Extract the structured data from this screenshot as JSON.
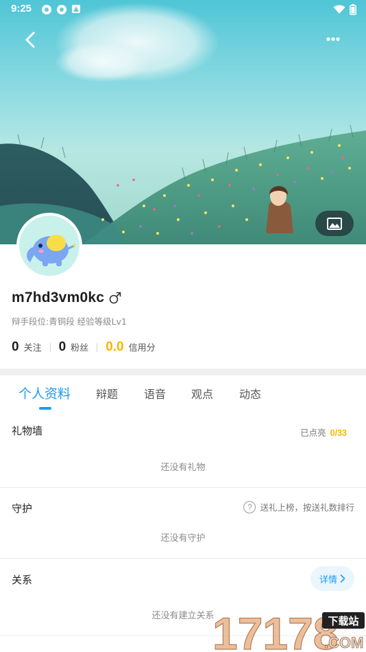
{
  "status_bar": {
    "time": "9:25"
  },
  "header": {
    "back_icon": "chevron-left-icon",
    "more_icon": "more-dots-icon",
    "wallpaper_icon": "image-icon"
  },
  "profile": {
    "username": "m7hd3vm0kc",
    "gender_symbol": "♂",
    "rank_line": "辩手段位:青铜段 经验等级Lv1",
    "stats": [
      {
        "value": "0",
        "label": "关注"
      },
      {
        "value": "0",
        "label": "粉丝"
      },
      {
        "value": "0.0",
        "label": "信用分"
      }
    ]
  },
  "tabs": [
    {
      "label": "个人资料",
      "active": true
    },
    {
      "label": "辩题",
      "active": false
    },
    {
      "label": "语音",
      "active": false
    },
    {
      "label": "观点",
      "active": false
    },
    {
      "label": "动态",
      "active": false
    }
  ],
  "gift_wall": {
    "title": "礼物墙",
    "lit_label": "已点亮",
    "lit_count": "0/33",
    "empty_text": "还没有礼物"
  },
  "guard": {
    "title": "守护",
    "hint": "送礼上榜，按送礼数排行",
    "empty_text": "还没有守护"
  },
  "relations": {
    "title": "关系",
    "details_label": "详情",
    "empty_text": "还没有建立关系"
  },
  "watermark": {
    "logo_text": "17178",
    "tag_text": "下载站",
    "domain_text": ".COM"
  },
  "colors": {
    "accent": "#1e9bf0",
    "gold": "#f7b500"
  }
}
